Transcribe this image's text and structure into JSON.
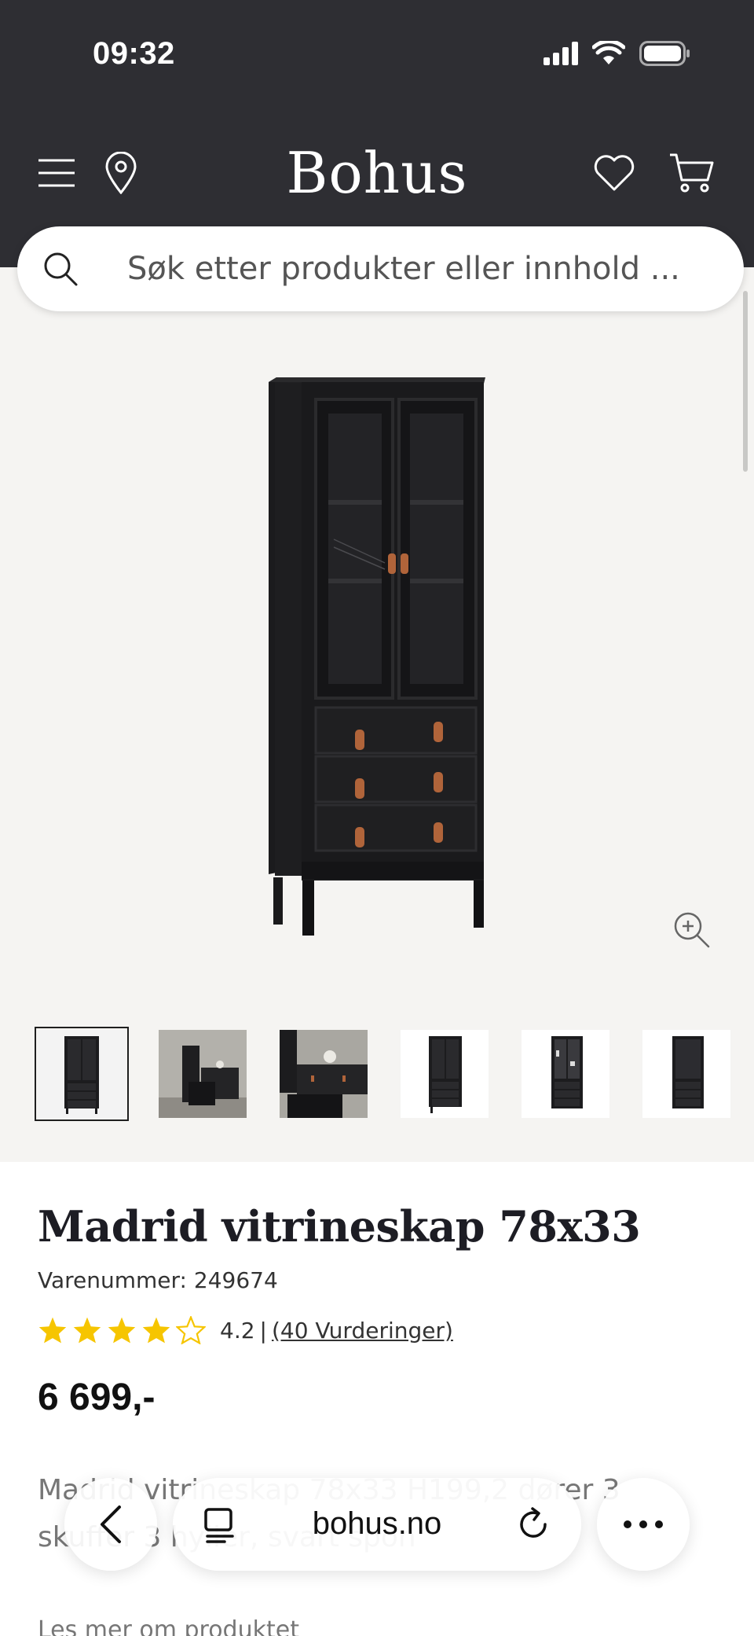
{
  "status_bar": {
    "time": "09:32"
  },
  "header": {
    "logo": "Bohus"
  },
  "search": {
    "placeholder": "Søk etter produkter eller innhold ..."
  },
  "colors": {
    "header_bg": "#2e2e33",
    "star": "#f6c500",
    "page_bg": "#f5f4f2"
  },
  "product": {
    "title": "Madrid vitrineskap 78x33",
    "sku": "Varenummer: 249674",
    "rating_value": "4.2",
    "rating_separator": "|",
    "rating_count": "(40 Vurderinger)",
    "stars": 4,
    "price": "6 699,-",
    "description": "Madrid vitrineskap 78x33 H199,2 dører 3 skuffer 3 hyller, svart spon",
    "read_more": "Les mer om produktet"
  },
  "thumbnails": [
    "cabinet-front",
    "room-scene",
    "room-scene-2",
    "cabinet-front",
    "cabinet-open",
    "cabinet-side"
  ],
  "safari": {
    "domain": "bohus.no"
  }
}
